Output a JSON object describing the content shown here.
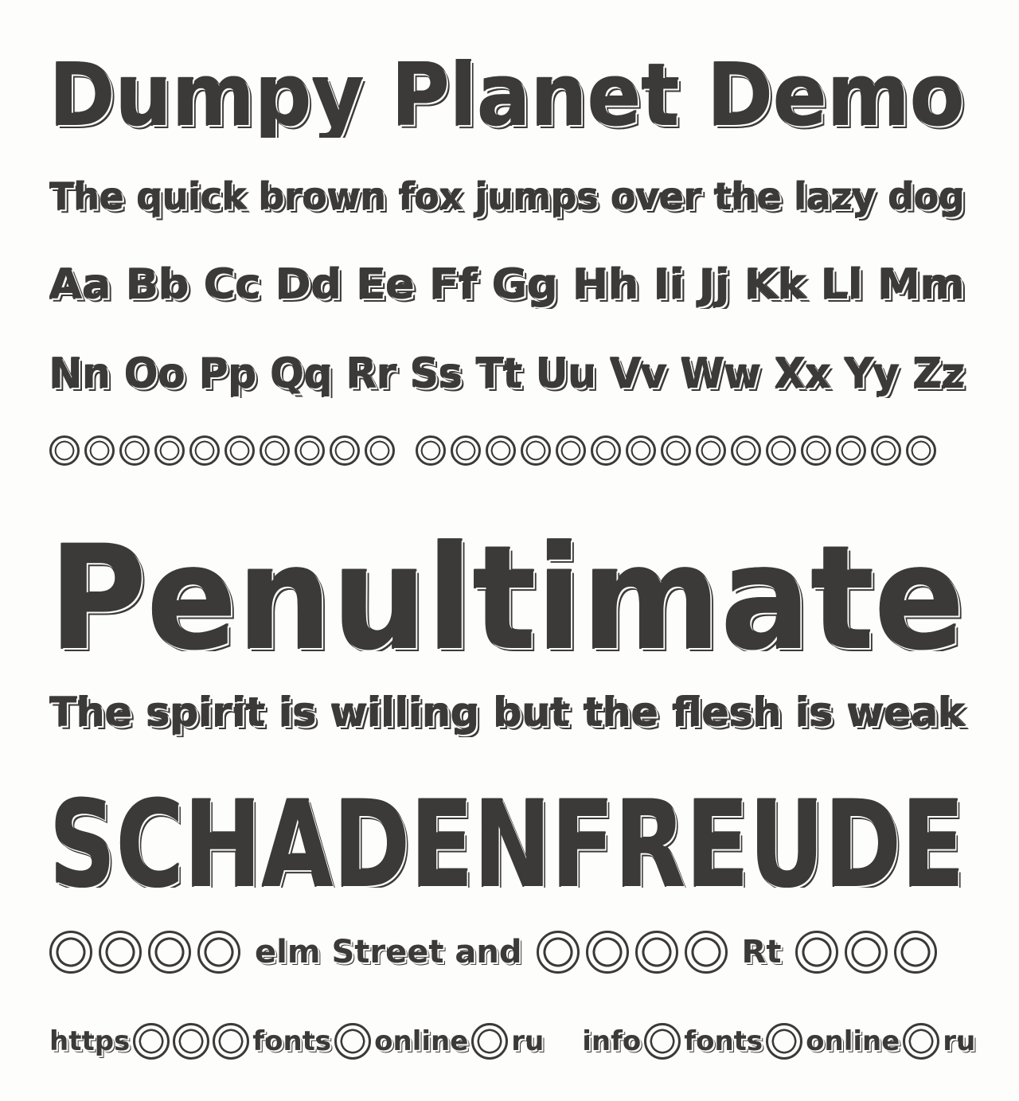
{
  "specimen": {
    "title": "Dumpy Planet Demo",
    "pangram": "The quick brown fox jumps over the lazy dog",
    "alphabet_row_1": "Aa Bb Cc Dd Ee Ff Gg Hh Ii Jj Kk Ll Mm",
    "alphabet_row_2": "Nn Oo Pp Qq Rr Ss Tt Uu Vv Ww Xx Yy Zz",
    "word_large_1": "Penultimate",
    "phrase": "The spirit is willing but the flesh is weak",
    "word_large_2": "SCHADENFREUDE",
    "street_words": [
      "elm Street and",
      "Rt"
    ],
    "url_words": [
      "https",
      "fonts",
      "online",
      "ru",
      "info",
      "fonts",
      "online",
      "ru"
    ],
    "badge_icon": "calligraphy-fonts-demo-badge-icon"
  }
}
